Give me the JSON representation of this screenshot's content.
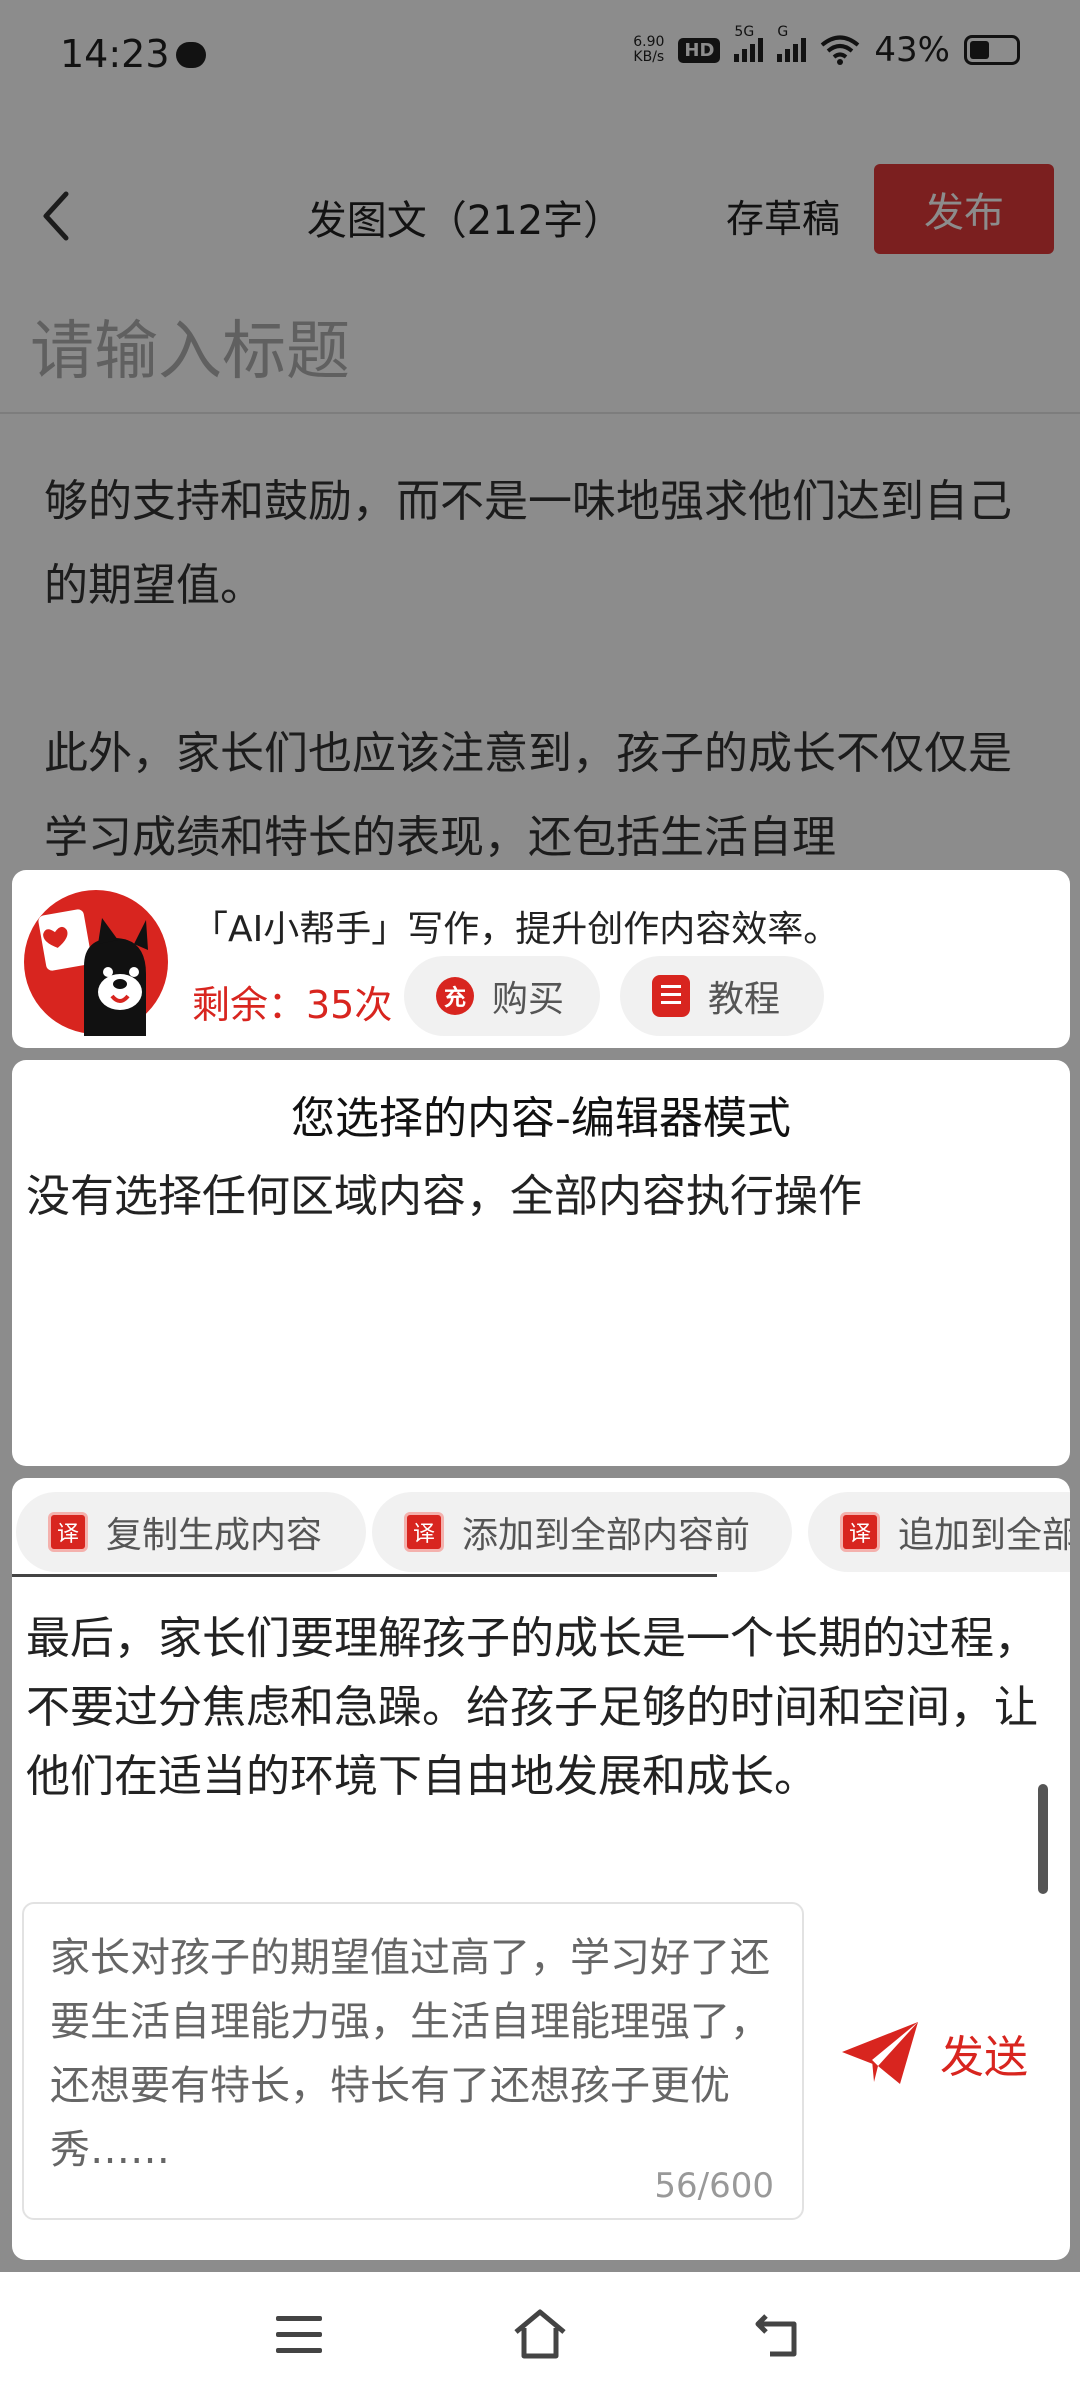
{
  "status_bar": {
    "time": "14:23",
    "net_speed_value": "6.90",
    "net_speed_unit": "KB/s",
    "hd_label": "HD",
    "sim1_label": "5G",
    "sim2_label": "G",
    "battery_percent": "43%"
  },
  "header": {
    "title": "发图文（212字）",
    "save_draft": "存草稿",
    "publish": "发布"
  },
  "editor": {
    "title_placeholder": "请输入标题",
    "paragraph_1": "够的支持和鼓励，而不是一味地强求他们达到自己的期望值。",
    "paragraph_2": "此外，家长们也应该注意到，孩子的成长不仅仅是学习成绩和特长的表现，还包括生活自理"
  },
  "ai_panel": {
    "tagline": "「AI小帮手」写作，提升创作内容效率。",
    "remaining": "剩余：35次",
    "buy_icon_char": "充",
    "buy_label": "购买",
    "tutorial_label": "教程",
    "selection_title": "您选择的内容-编辑器模式",
    "selection_desc": "没有选择任何区域内容，全部内容执行操作",
    "action_icon_char": "译",
    "actions": [
      "复制生成内容",
      "添加到全部内容前",
      "追加到全部"
    ],
    "result_text": "最后，家长们要理解孩子的成长是一个长期的过程，不要过分焦虑和急躁。给孩子足够的时间和空间，让他们在适当的环境下自由地发展和成长。",
    "prompt_text": "家长对孩子的期望值过高了，学习好了还要生活自理能力强，生活自理能理强了，还想要有特长，特长有了还想孩子更优秀……",
    "char_count": "56/600",
    "send_label": "发送"
  },
  "colors": {
    "accent_red": "#d8251f",
    "publish_red": "#e03a3a"
  }
}
